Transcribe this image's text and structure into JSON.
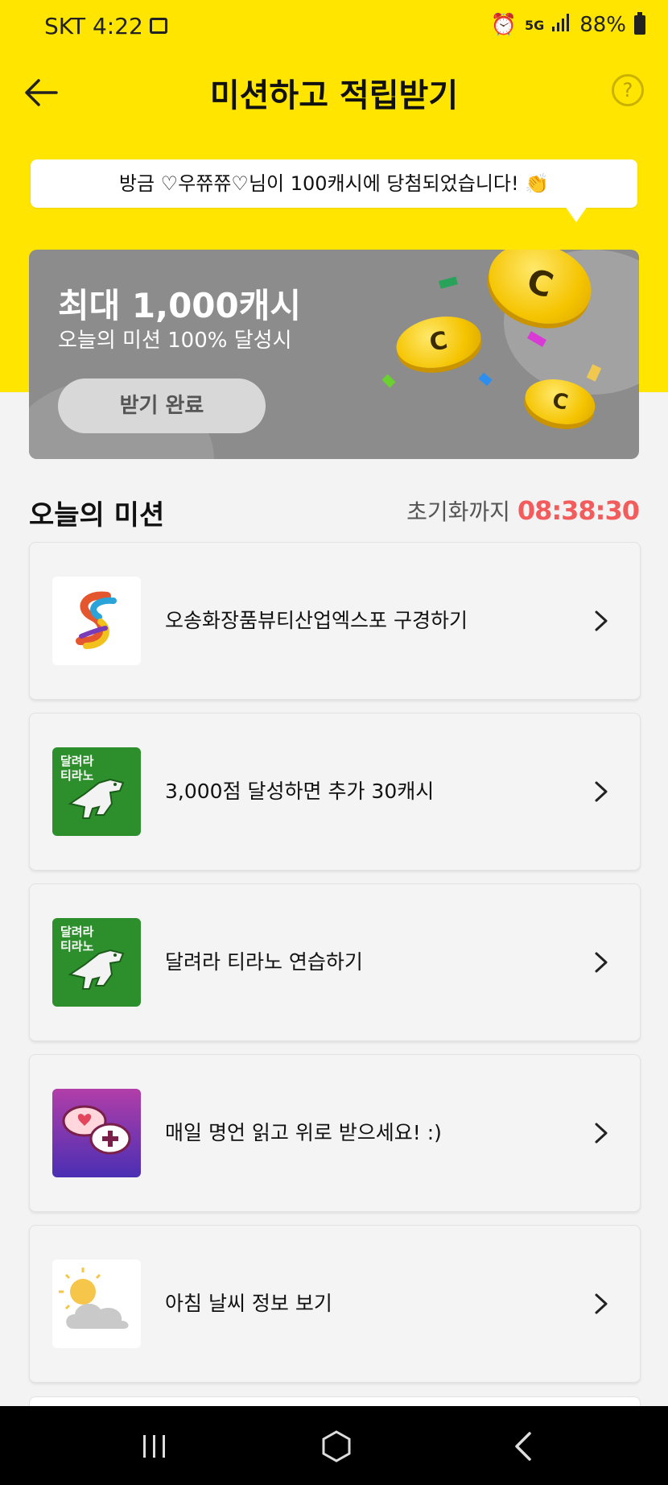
{
  "status_bar": {
    "carrier_time": "SKT 4:22",
    "network": "5G",
    "battery": "88%"
  },
  "header": {
    "title": "미션하고 적립받기",
    "help_label": "?"
  },
  "ticker": {
    "text": "방금 ♡우쮸쮸♡님이 100캐시에 당첨되었습니다! 👏"
  },
  "hero": {
    "title": "최대 1,000캐시",
    "subtitle": "오늘의 미션 100% 달성시",
    "button_label": "받기 완료",
    "coin_label": "C"
  },
  "missions": {
    "section_title": "오늘의 미션",
    "reset_label": "초기화까지",
    "reset_time": "08:38:30",
    "items": [
      {
        "label": "오송화장품뷰티산업엑스포 구경하기"
      },
      {
        "label": "3,000점 달성하면 추가 30캐시",
        "thumb_text": "달려라\n티라노"
      },
      {
        "label": "달려라 티라노 연습하기",
        "thumb_text": "달려라\n티라노"
      },
      {
        "label": "매일 명언 읽고 위로 받으세요! :)"
      },
      {
        "label": "아침 날씨 정보 보기"
      }
    ]
  },
  "colors": {
    "brand_yellow": "#ffe500",
    "timer_red": "#f35c5c",
    "hero_gray": "#8c8c8c"
  }
}
